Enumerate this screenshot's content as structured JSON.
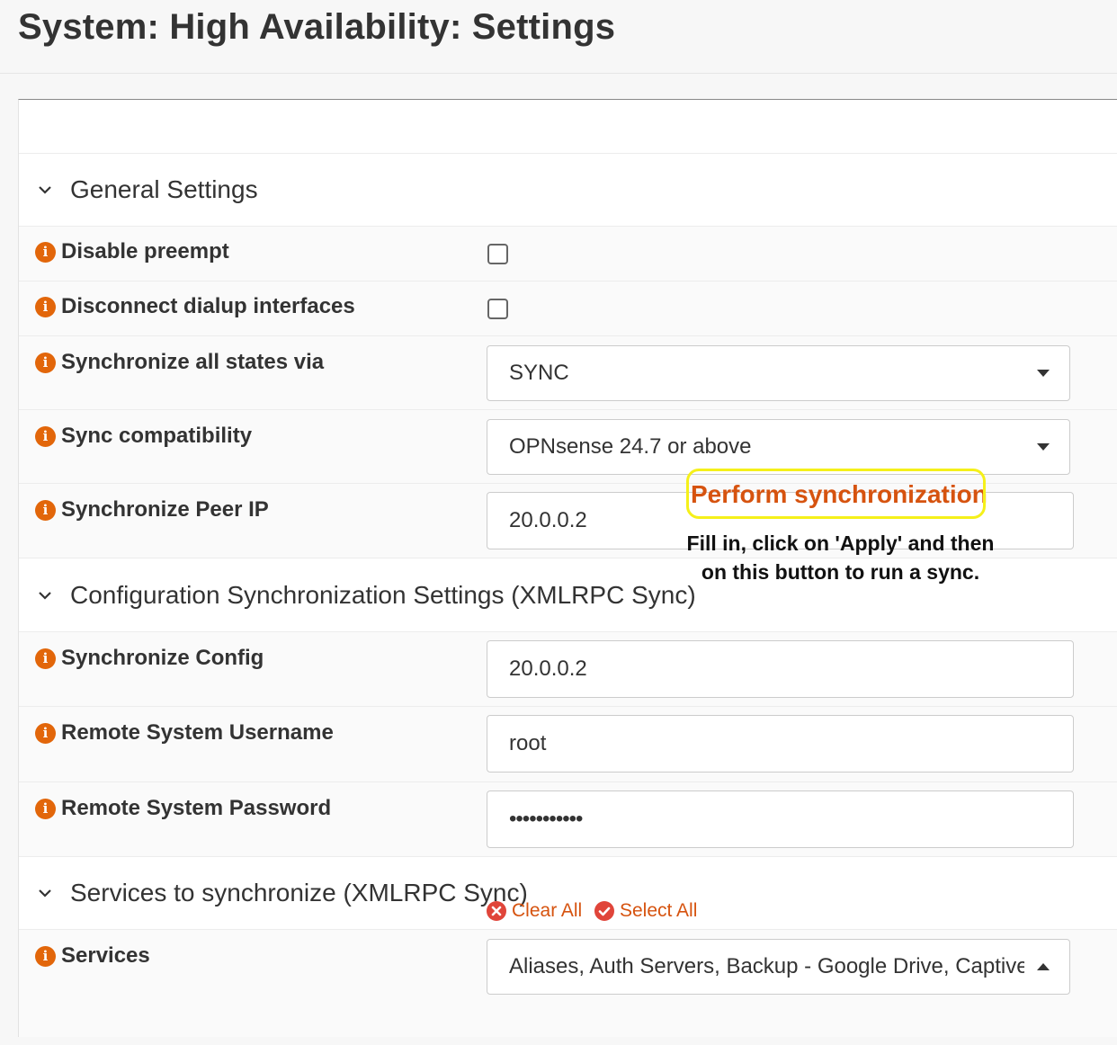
{
  "page": {
    "title": "System: High Availability: Settings"
  },
  "sections": {
    "general": {
      "title": "General Settings"
    },
    "config_sync": {
      "title": "Configuration Synchronization Settings (XMLRPC Sync)",
      "action": "Perform synchronization"
    },
    "services_sync": {
      "title": "Services to synchronize (XMLRPC Sync)"
    }
  },
  "fields": {
    "disable_preempt": {
      "label": "Disable preempt",
      "checked": false
    },
    "disconnect_dialup": {
      "label": "Disconnect dialup interfaces",
      "checked": false
    },
    "sync_states_via": {
      "label": "Synchronize all states via",
      "value": "SYNC"
    },
    "sync_compat": {
      "label": "Sync compatibility",
      "value": "OPNsense 24.7 or above"
    },
    "sync_peer_ip": {
      "label": "Synchronize Peer IP",
      "value": "20.0.0.2"
    },
    "sync_config": {
      "label": "Synchronize Config",
      "value": "20.0.0.2"
    },
    "remote_username": {
      "label": "Remote System Username",
      "value": "root"
    },
    "remote_password": {
      "label": "Remote System Password",
      "value": "•••••••••••"
    },
    "services": {
      "label": "Services",
      "value": "Aliases, Auth Servers, Backup - Google Drive, Captive Portal"
    }
  },
  "buttons": {
    "clear_all": "Clear All",
    "select_all": "Select All"
  },
  "annotation": {
    "line1": "Fill in, click on 'Apply' and then",
    "line2": "on this button to run a sync."
  },
  "colors": {
    "accent": "#d6530f",
    "highlight": "#f5f01a",
    "info_icon": "#e2660a"
  }
}
